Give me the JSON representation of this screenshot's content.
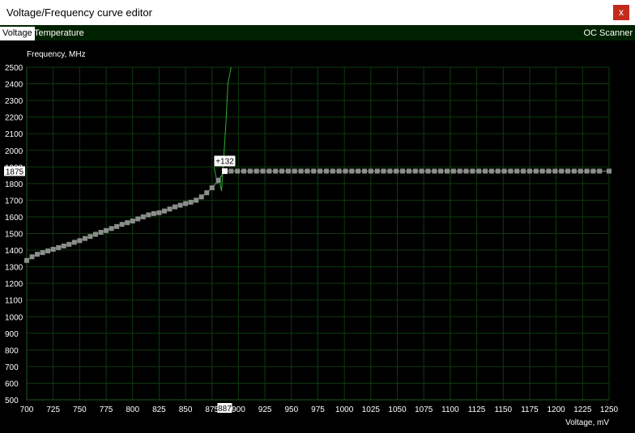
{
  "window": {
    "title": "Voltage/Frequency curve editor",
    "close_label": "x"
  },
  "tabs": [
    {
      "label": "Voltage",
      "active": true
    },
    {
      "label": "Temperature",
      "active": false
    }
  ],
  "oc_scanner_label": "OC Scanner",
  "colors": {
    "grid": "#0d3b0d",
    "point": "#8a8f8a",
    "line": "#5e6b5e",
    "spike": "#2fae2f",
    "tabbar_bg": "#002200"
  },
  "chart_data": {
    "type": "line",
    "ylabel": "Frequency, MHz",
    "xlabel": "Voltage, mV",
    "xlim": [
      700,
      1250
    ],
    "ylim": [
      500,
      2500
    ],
    "x_ticks": [
      700,
      725,
      750,
      775,
      800,
      825,
      850,
      875,
      900,
      925,
      950,
      975,
      1000,
      1025,
      1050,
      1075,
      1100,
      1125,
      1150,
      1175,
      1200,
      1225,
      1250
    ],
    "y_ticks": [
      500,
      600,
      700,
      800,
      900,
      1000,
      1100,
      1200,
      1300,
      1400,
      1500,
      1600,
      1700,
      1800,
      1900,
      2000,
      2100,
      2200,
      2300,
      2400,
      2500
    ],
    "series": [
      {
        "x": [
          700,
          705,
          710,
          715,
          720,
          725,
          730,
          735,
          740,
          745,
          750,
          755,
          760,
          765,
          770,
          775,
          780,
          785,
          790,
          795,
          800,
          805,
          810,
          815,
          820,
          825,
          830,
          835,
          840,
          845,
          850,
          855,
          860,
          865,
          870,
          875,
          881,
          887,
          893,
          899,
          905,
          911,
          917,
          923,
          929,
          935,
          941,
          947,
          953,
          959,
          965,
          971,
          977,
          983,
          989,
          995,
          1001,
          1007,
          1013,
          1019,
          1025,
          1031,
          1037,
          1043,
          1049,
          1055,
          1061,
          1067,
          1073,
          1079,
          1085,
          1091,
          1097,
          1103,
          1109,
          1115,
          1121,
          1127,
          1133,
          1139,
          1145,
          1151,
          1157,
          1163,
          1169,
          1175,
          1181,
          1187,
          1193,
          1199,
          1205,
          1211,
          1217,
          1223,
          1229,
          1235,
          1241,
          1250
        ],
        "y": [
          1338,
          1360,
          1375,
          1385,
          1395,
          1405,
          1415,
          1425,
          1435,
          1447,
          1457,
          1470,
          1482,
          1495,
          1507,
          1518,
          1530,
          1542,
          1555,
          1565,
          1575,
          1588,
          1600,
          1612,
          1620,
          1625,
          1635,
          1647,
          1660,
          1670,
          1680,
          1688,
          1700,
          1720,
          1745,
          1775,
          1820,
          1875,
          1875,
          1875,
          1875,
          1875,
          1875,
          1875,
          1875,
          1875,
          1875,
          1875,
          1875,
          1875,
          1875,
          1875,
          1875,
          1875,
          1875,
          1875,
          1875,
          1875,
          1875,
          1875,
          1875,
          1875,
          1875,
          1875,
          1875,
          1875,
          1875,
          1875,
          1875,
          1875,
          1875,
          1875,
          1875,
          1875,
          1875,
          1875,
          1875,
          1875,
          1875,
          1875,
          1875,
          1875,
          1875,
          1875,
          1875,
          1875,
          1875,
          1875,
          1875,
          1875,
          1875,
          1875,
          1875,
          1875,
          1875,
          1875,
          1875,
          1875
        ]
      },
      {
        "x": [
          877,
          880,
          882,
          884,
          886,
          888,
          890,
          893
        ],
        "y": [
          1900,
          1800,
          1820,
          1755,
          1950,
          2150,
          2400,
          2500
        ]
      }
    ],
    "selected_point": {
      "x": 887,
      "y": 1875,
      "offset_label": "+132",
      "x_label": "887",
      "y_label": "1875"
    }
  }
}
